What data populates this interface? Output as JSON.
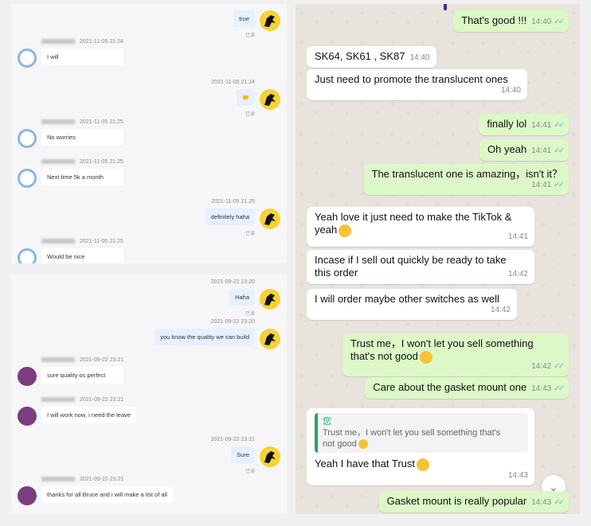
{
  "panel_a": {
    "messages": [
      {
        "dir": "out",
        "meta": "",
        "text": "true",
        "read": "已读"
      },
      {
        "dir": "in",
        "meta": "2021-11-05 21:24",
        "text": "I will"
      },
      {
        "dir": "out",
        "meta": "2021-11-05 21:24",
        "text": "🤝",
        "read": "已读"
      },
      {
        "dir": "in",
        "meta": "2021-11-05 21:25",
        "text": "No worries"
      },
      {
        "dir": "in",
        "meta": "2021-11-05 21:25",
        "text": "Next time 5k a month"
      },
      {
        "dir": "out",
        "meta": "2021-11-05 21:25",
        "text": "definitely haha",
        "read": "已读"
      },
      {
        "dir": "in",
        "meta": "2021-11-05 21:25",
        "text": "Would be nice"
      }
    ]
  },
  "panel_b": {
    "messages": [
      {
        "dir": "out",
        "meta": "2021-09-22 23:20",
        "text": "Haha",
        "read": "已读"
      },
      {
        "dir": "out",
        "meta": "2021-09-22 23:20",
        "text": "you know the quality we can build",
        "read": ""
      },
      {
        "dir": "in",
        "meta": "2021-09-22 23:21",
        "text": "sure quality os perfect"
      },
      {
        "dir": "in",
        "meta": "2021-09-22 23:21",
        "text": "I will work now, i need the leave"
      },
      {
        "dir": "out",
        "meta": "2021-09-22 23:21",
        "text": "Sure",
        "read": "已读"
      },
      {
        "dir": "in",
        "meta": "2021-09-22 23:21",
        "text": "thanks for all Bruce and i will make a list of all"
      }
    ]
  },
  "whatsapp": {
    "messages": [
      {
        "dir": "out",
        "text": "That's good !!!",
        "time": "14:40",
        "ticks": true
      },
      {
        "dir": "in",
        "text": "SK64, SK61 , SK87",
        "time": "14:40"
      },
      {
        "dir": "in",
        "text": "Just need to promote the translucent ones",
        "time": "14:40"
      },
      {
        "dir": "out",
        "text": "finally lol",
        "time": "14:41",
        "ticks": true
      },
      {
        "dir": "out",
        "text": "Oh yeah",
        "time": "14:41",
        "ticks": true
      },
      {
        "dir": "out",
        "text": "The translucent one is amazing，isn't it？",
        "time": "14:41",
        "ticks": true
      },
      {
        "dir": "in",
        "text": "Yeah love it just need to make the TikTok &",
        "text2": "yeah",
        "time": "14:41",
        "emoji": "heart-eyes"
      },
      {
        "dir": "in",
        "text": "Incase if I sell out quickly be ready to take",
        "text2": "this order",
        "time": "14:42"
      },
      {
        "dir": "in",
        "text": "I will order maybe other switches as well",
        "time": "14:42"
      },
      {
        "dir": "out",
        "text": "Trust me，I won't let you sell something",
        "text2": "that's not good",
        "time": "14:42",
        "ticks": true,
        "emoji": "sweat-smile"
      },
      {
        "dir": "out",
        "text": "Care about the gasket mount one",
        "time": "14:43",
        "ticks": true
      },
      {
        "dir": "in",
        "quote_name": "您",
        "quote_text": "Trust me，I won't let you sell something that's",
        "quote_text2": "not good",
        "text": "Yeah I have that Trust",
        "time": "14:43",
        "emoji": "pleading"
      },
      {
        "dir": "out",
        "text": "Gasket mount is really popular",
        "time": "14:43",
        "ticks": true
      }
    ],
    "scroll_icon": "chevron-double-down-icon",
    "colors": {
      "out_bubble": "#dcf8c6",
      "in_bubble": "#ffffff",
      "ticks": "#4fb6ec",
      "quote_bar": "#25a36a"
    }
  }
}
